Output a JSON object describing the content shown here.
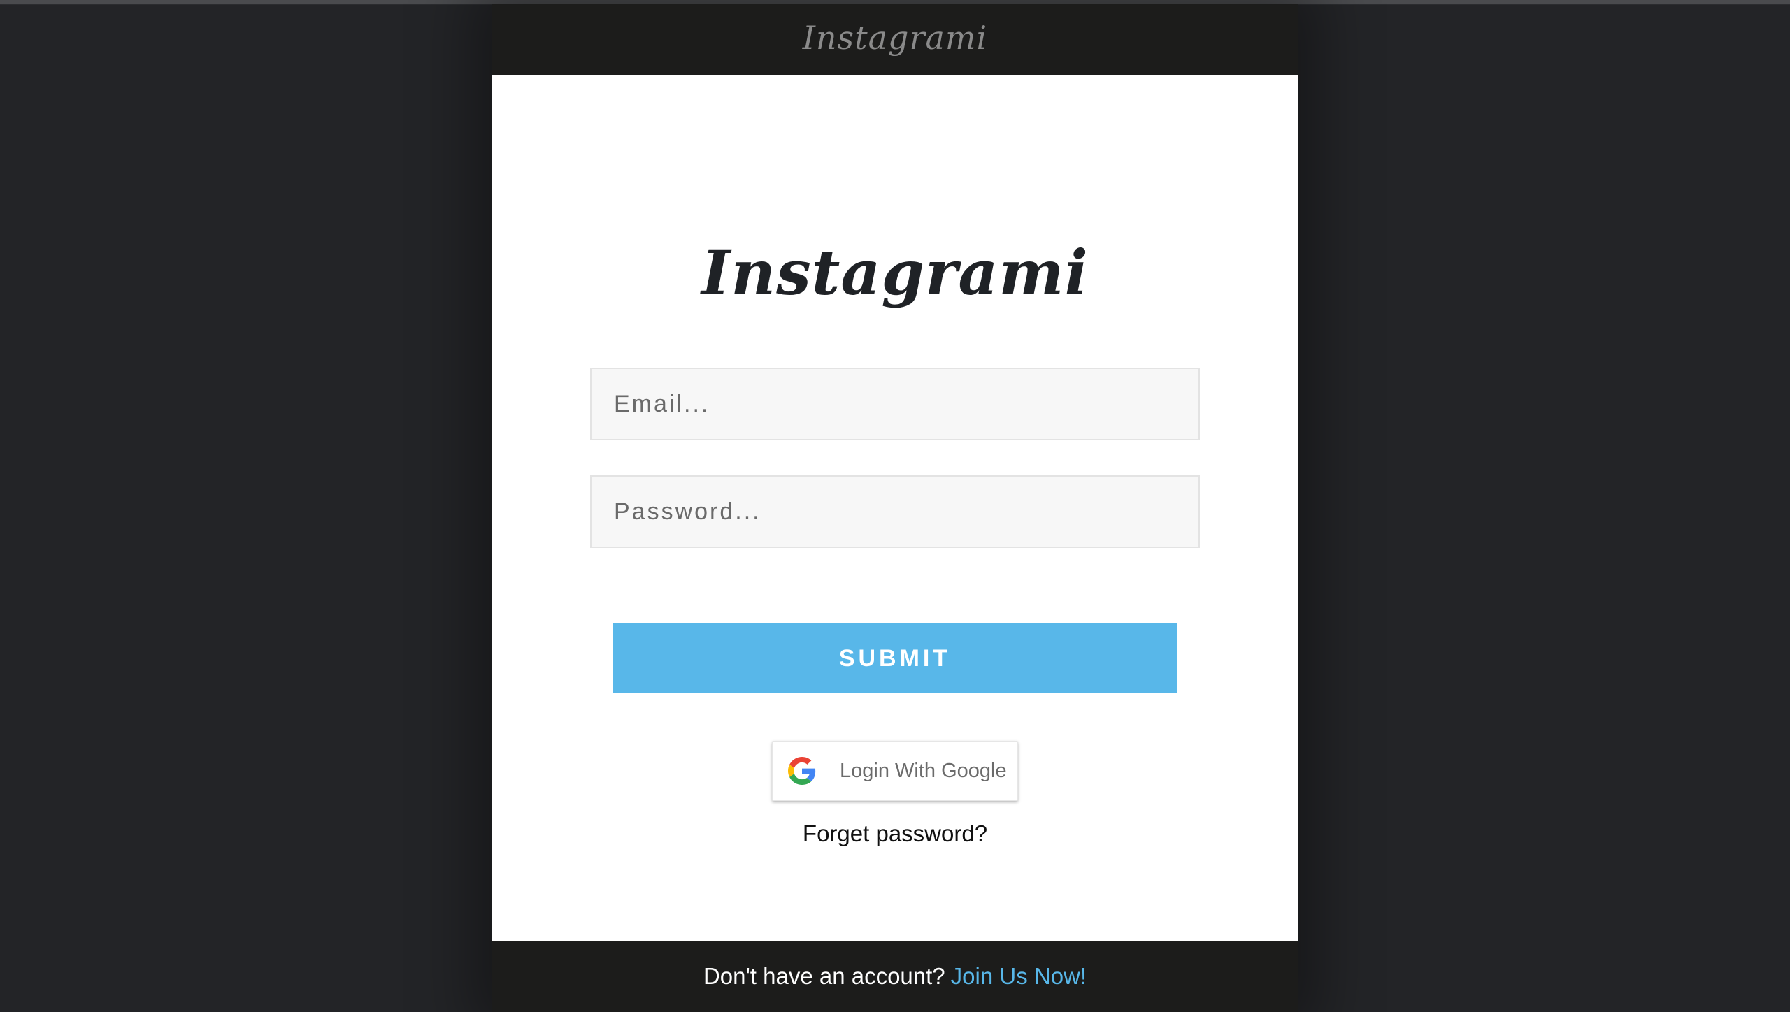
{
  "navbar": {
    "brand": "Instagrami"
  },
  "login": {
    "logo": "Instagrami",
    "email": {
      "placeholder": "Email...",
      "value": ""
    },
    "password": {
      "placeholder": "Password...",
      "value": ""
    },
    "submit_label": "SUBMIT",
    "google": {
      "label": "Login With Google",
      "icon": "google-g-icon"
    },
    "forget_label": "Forget password?"
  },
  "footer": {
    "prompt": "Don't have an account?",
    "link_label": "Join Us Now!"
  },
  "colors": {
    "background": "#232427",
    "navbar": "#1c1c1b",
    "accent": "#58b7e9",
    "card": "#ffffff"
  }
}
